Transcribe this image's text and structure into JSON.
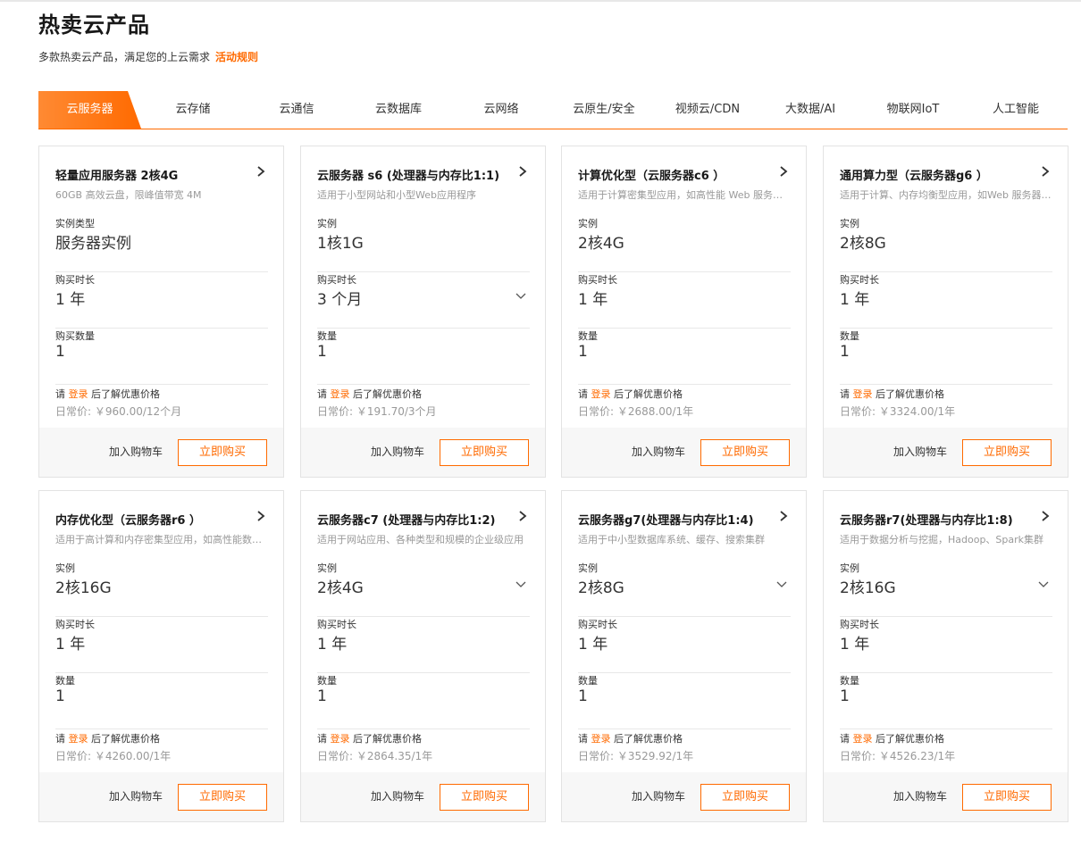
{
  "header": {
    "title": "热卖云产品",
    "subtitle": "多款热卖云产品，满足您的上云需求",
    "rules_link": "活动规则"
  },
  "colors": {
    "accent": "#ff6a00",
    "tab_gradient_start": "#ff8a33",
    "tab_gradient_end": "#ff6a00"
  },
  "tabs": [
    {
      "label": "云服务器",
      "active": true
    },
    {
      "label": "云存储"
    },
    {
      "label": "云通信"
    },
    {
      "label": "云数据库"
    },
    {
      "label": "云网络"
    },
    {
      "label": "云原生/安全"
    },
    {
      "label": "视频云/CDN"
    },
    {
      "label": "大数据/AI"
    },
    {
      "label": "物联网IoT"
    },
    {
      "label": "人工智能"
    }
  ],
  "cards": [
    {
      "title": "轻量应用服务器 2核4G",
      "desc": "60GB 高效云盘，限峰值带宽 4M",
      "f1_label": "实例类型",
      "f1_value": "服务器实例",
      "f1_dropdown": false,
      "f2_label": "购买时长",
      "f2_value": "1 年",
      "f2_dropdown": false,
      "f3_label": "购买数量",
      "f3_value": "1",
      "note_prefix": "请",
      "note_login": "登录",
      "note_suffix": "后了解优惠价格",
      "regular_price": "日常价: ￥960.00/12个月",
      "cart": "加入购物车",
      "buy": "立即购买"
    },
    {
      "title": "云服务器 s6 (处理器与内存比1:1)",
      "desc": "适用于小型网站和小型Web应用程序",
      "f1_label": "实例",
      "f1_value": "1核1G",
      "f1_dropdown": false,
      "f2_label": "购买时长",
      "f2_value": "3 个月",
      "f2_dropdown": true,
      "f3_label": "数量",
      "f3_value": "1",
      "note_prefix": "请",
      "note_login": "登录",
      "note_suffix": "后了解优惠价格",
      "regular_price": "日常价: ￥191.70/3个月",
      "cart": "加入购物车",
      "buy": "立即购买"
    },
    {
      "title": "计算优化型（云服务器c6 ）",
      "desc": "适用于计算密集型应用，如高性能 Web 服务器、批处理",
      "f1_label": "实例",
      "f1_value": "2核4G",
      "f1_dropdown": false,
      "f2_label": "购买时长",
      "f2_value": "1 年",
      "f2_dropdown": false,
      "f3_label": "数量",
      "f3_value": "1",
      "note_prefix": "请",
      "note_login": "登录",
      "note_suffix": "后了解优惠价格",
      "regular_price": "日常价: ￥2688.00/1年",
      "cart": "加入购物车",
      "buy": "立即购买"
    },
    {
      "title": "通用算力型（云服务器g6 ）",
      "desc": "适用于计算、内存均衡型应用，如Web 服务器、中间件",
      "f1_label": "实例",
      "f1_value": "2核8G",
      "f1_dropdown": false,
      "f2_label": "购买时长",
      "f2_value": "1 年",
      "f2_dropdown": false,
      "f3_label": "数量",
      "f3_value": "1",
      "note_prefix": "请",
      "note_login": "登录",
      "note_suffix": "后了解优惠价格",
      "regular_price": "日常价: ￥3324.00/1年",
      "cart": "加入购物车",
      "buy": "立即购买"
    },
    {
      "title": "内存优化型（云服务器r6 ）",
      "desc": "适用于高计算和内存密集型应用，如高性能数据库",
      "f1_label": "实例",
      "f1_value": "2核16G",
      "f1_dropdown": false,
      "f2_label": "购买时长",
      "f2_value": "1 年",
      "f2_dropdown": false,
      "f3_label": "数量",
      "f3_value": "1",
      "note_prefix": "请",
      "note_login": "登录",
      "note_suffix": "后了解优惠价格",
      "regular_price": "日常价: ￥4260.00/1年",
      "cart": "加入购物车",
      "buy": "立即购买"
    },
    {
      "title": "云服务器c7 (处理器与内存比1:2)",
      "desc": "适用于网站应用、各种类型和规模的企业级应用",
      "f1_label": "实例",
      "f1_value": "2核4G",
      "f1_dropdown": true,
      "f2_label": "购买时长",
      "f2_value": "1 年",
      "f2_dropdown": false,
      "f3_label": "数量",
      "f3_value": "1",
      "note_prefix": "请",
      "note_login": "登录",
      "note_suffix": "后了解优惠价格",
      "regular_price": "日常价: ￥2864.35/1年",
      "cart": "加入购物车",
      "buy": "立即购买"
    },
    {
      "title": "云服务器g7(处理器与内存比1:4)",
      "desc": "适用于中小型数据库系统、缓存、搜索集群",
      "f1_label": "实例",
      "f1_value": "2核8G",
      "f1_dropdown": true,
      "f2_label": "购买时长",
      "f2_value": "1 年",
      "f2_dropdown": false,
      "f3_label": "数量",
      "f3_value": "1",
      "note_prefix": "请",
      "note_login": "登录",
      "note_suffix": "后了解优惠价格",
      "regular_price": "日常价: ￥3529.92/1年",
      "cart": "加入购物车",
      "buy": "立即购买"
    },
    {
      "title": "云服务器r7(处理器与内存比1:8)",
      "desc": "适用于数据分析与挖掘，Hadoop、Spark集群",
      "f1_label": "实例",
      "f1_value": "2核16G",
      "f1_dropdown": true,
      "f2_label": "购买时长",
      "f2_value": "1 年",
      "f2_dropdown": false,
      "f3_label": "数量",
      "f3_value": "1",
      "note_prefix": "请",
      "note_login": "登录",
      "note_suffix": "后了解优惠价格",
      "regular_price": "日常价: ￥4526.23/1年",
      "cart": "加入购物车",
      "buy": "立即购买"
    }
  ]
}
